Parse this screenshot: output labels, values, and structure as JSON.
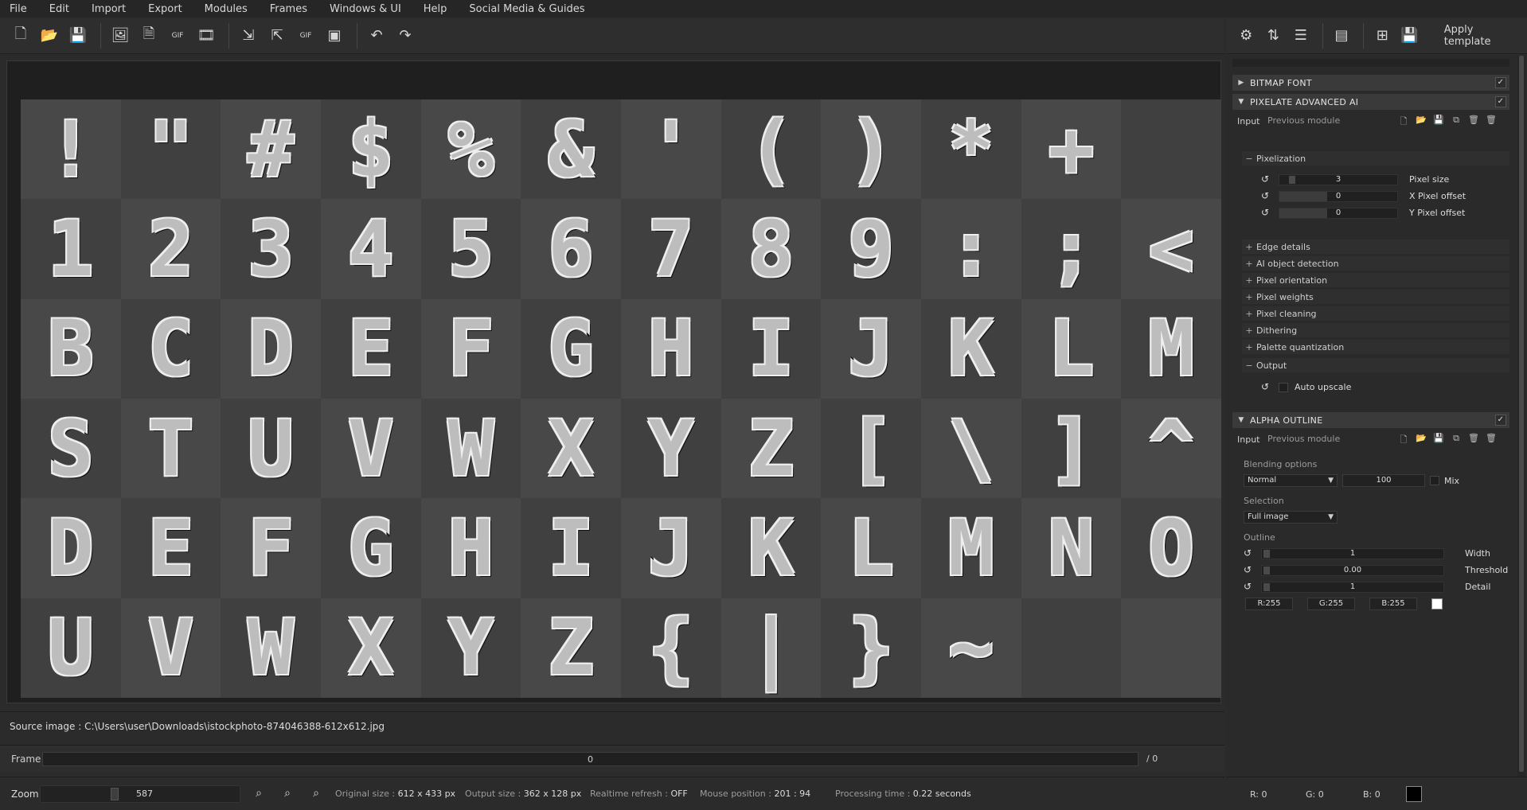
{
  "menu": [
    "File",
    "Edit",
    "Import",
    "Export",
    "Modules",
    "Frames",
    "Windows & UI",
    "Help",
    "Social Media & Guides"
  ],
  "toolbar": {
    "icons": [
      "new-file-icon",
      "open-folder-icon",
      "save-icon",
      "open-image-icon",
      "save-image-icon",
      "gif-icon",
      "video-icon",
      "import-frames-icon",
      "export-frames-icon",
      "export-gif-icon",
      "export-video-icon",
      "undo-icon",
      "redo-icon"
    ],
    "apply_template": "Apply template"
  },
  "glyphs": [
    [
      "!",
      "\"",
      "#",
      "$",
      "%",
      "&",
      "'",
      "(",
      ")",
      "*",
      "+",
      ""
    ],
    [
      "1",
      "2",
      "3",
      "4",
      "5",
      "6",
      "7",
      "8",
      "9",
      ":",
      ";",
      "<"
    ],
    [
      "B",
      "C",
      "D",
      "E",
      "F",
      "G",
      "H",
      "I",
      "J",
      "K",
      "L",
      "M"
    ],
    [
      "S",
      "T",
      "U",
      "V",
      "W",
      "X",
      "Y",
      "Z",
      "[",
      "\\",
      "]",
      "^"
    ],
    [
      "D",
      "E",
      "F",
      "G",
      "H",
      "I",
      "J",
      "K",
      "L",
      "M",
      "N",
      "O"
    ],
    [
      "U",
      "V",
      "W",
      "X",
      "Y",
      "Z",
      "{",
      "|",
      "}",
      "~",
      "",
      ""
    ]
  ],
  "source": {
    "label": "Source image : C:\\Users\\user\\Downloads\\istockphoto-874046388-612x612.jpg"
  },
  "frame": {
    "label": "Frame",
    "value": "0",
    "total": "/ 0"
  },
  "status": {
    "zoom_label": "Zoom",
    "zoom_value": "587",
    "original_size_label": "Original size :",
    "original_size": "612 x 433 px",
    "output_size_label": "Output size :",
    "output_size": "362 x 128 px",
    "realtime_label": "Realtime refresh :",
    "realtime": "OFF",
    "mouse_label": "Mouse position :",
    "mouse": "201 : 94",
    "processing_label": "Processing time :",
    "processing": "0.22 seconds"
  },
  "panel": {
    "modules": [
      {
        "title": "BITMAP FONT",
        "collapsed": true
      },
      {
        "title": "PIXELATE ADVANCED AI",
        "collapsed": false
      },
      {
        "title": "ALPHA OUTLINE",
        "collapsed": false
      }
    ],
    "io_input": "Input",
    "io_prev": "Previous module",
    "pixelization": "Pixelization",
    "pixel_size": {
      "value": "3",
      "label": "Pixel size"
    },
    "x_offset": {
      "value": "0",
      "label": "X Pixel offset"
    },
    "y_offset": {
      "value": "0",
      "label": "Y Pixel offset"
    },
    "sections": [
      "Edge details",
      "AI object detection",
      "Pixel orientation",
      "Pixel weights",
      "Pixel cleaning",
      "Dithering",
      "Palette quantization"
    ],
    "output": "Output",
    "auto_upscale": "Auto upscale",
    "blending_options": "Blending options",
    "blend_mode": "Normal",
    "blend_value": "100",
    "mix": "Mix",
    "selection": "Selection",
    "selection_value": "Full image",
    "outline": "Outline",
    "width": {
      "value": "1",
      "label": "Width"
    },
    "threshold": {
      "value": "0.00",
      "label": "Threshold"
    },
    "detail": {
      "value": "1",
      "label": "Detail"
    },
    "r": "R:255",
    "g": "G:255",
    "b": "B:255",
    "outline_color": "#ffffff",
    "status_r": "R: 0",
    "status_g": "G: 0",
    "status_b": "B: 0",
    "status_color": "#000000"
  }
}
